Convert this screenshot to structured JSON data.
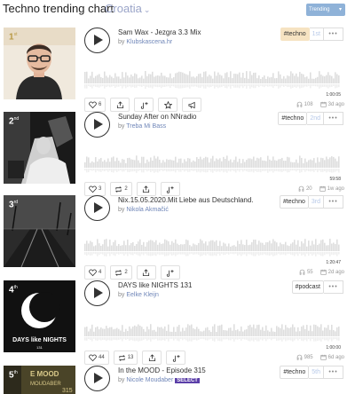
{
  "header": {
    "title": "Techno trending chart",
    "country": "Croatia",
    "trending_label": "Trending"
  },
  "tracks": [
    {
      "rank": "1",
      "rank_suffix": "st",
      "title": "Sam Wax - Jezgra 3.3 Mix",
      "by_prefix": "by",
      "artist": "Klubskascena.hr",
      "tag": "#techno",
      "position": "1st",
      "duration": "1:00:05",
      "like_count": "6",
      "plays": "108",
      "age": "3d ago"
    },
    {
      "rank": "2",
      "rank_suffix": "nd",
      "title": "Sunday After on NNradio",
      "by_prefix": "by",
      "artist": "Treba Mi Bass",
      "tag": "#techno",
      "position": "2nd",
      "duration": "59:58",
      "like_count": "3",
      "repost_count": "2",
      "plays": "20",
      "age": "1w ago"
    },
    {
      "rank": "3",
      "rank_suffix": "rd",
      "title": "Nix.15.05.2020.Mit Liebe aus Deutschland.",
      "by_prefix": "by",
      "artist": "Nikola Akmačić",
      "tag": "#techno",
      "position": "3rd",
      "duration": "1:20:47",
      "like_count": "4",
      "repost_count": "2",
      "plays": "55",
      "age": "2d ago"
    },
    {
      "rank": "4",
      "rank_suffix": "th",
      "title": "DAYS like NIGHTS 131",
      "by_prefix": "by",
      "artist": "Eelke Kleijn",
      "tag": "#podcast",
      "position": "",
      "duration": "1:00:00",
      "like_count": "44",
      "repost_count": "13",
      "plays": "985",
      "age": "6d ago",
      "art_text": "DAYS like NIGHTS",
      "art_number": "131"
    },
    {
      "rank": "5",
      "rank_suffix": "th",
      "title": "In the MOOD - Episode 315",
      "by_prefix": "by",
      "artist": "Nicole Moudaber",
      "select_badge": "SELECT",
      "tag": "#techno",
      "position": "5th",
      "art_text": "E MOOD",
      "art_sub": "MOUDABER",
      "art_number": "315"
    }
  ],
  "colors": {
    "accent": "#8fb2d8",
    "link": "#6f86b8",
    "wave": "#dedede",
    "tag_highlight": "#f6e3c2"
  }
}
